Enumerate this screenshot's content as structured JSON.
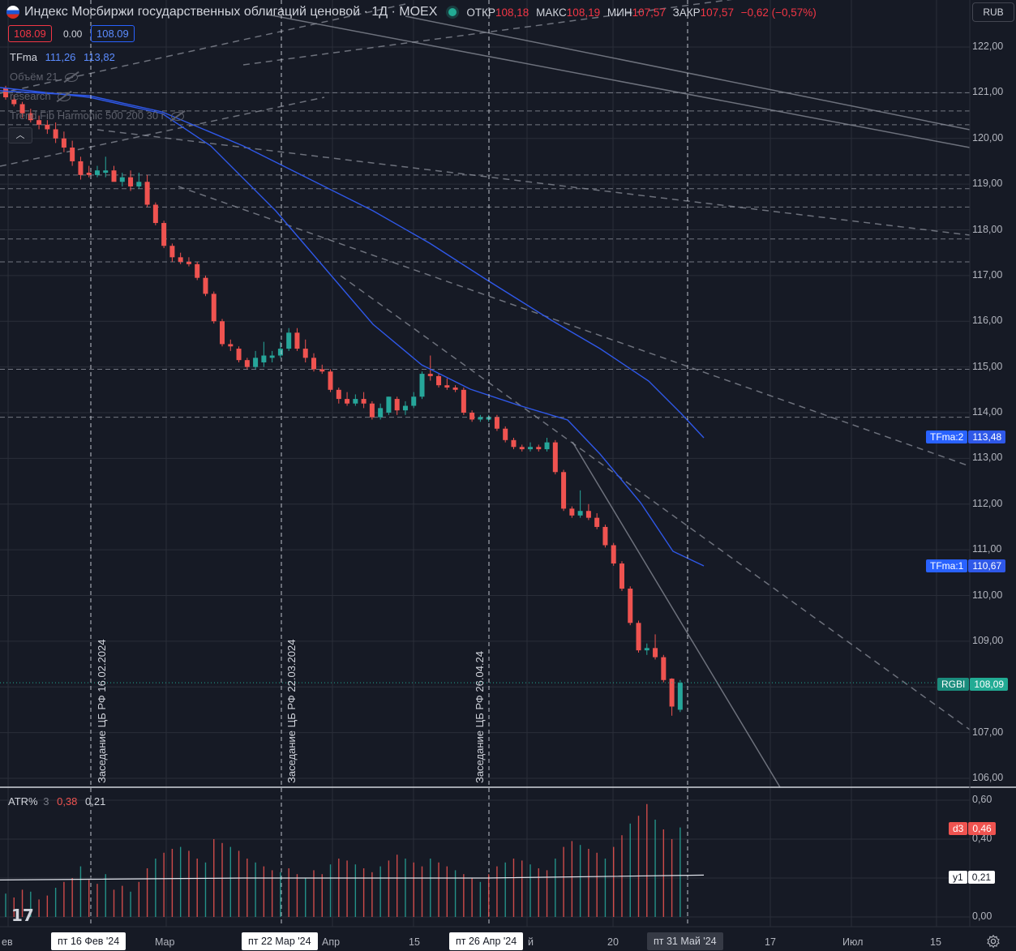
{
  "header": {
    "title": "Индекс Мосбиржи государственных облигаций ценовой · 1Д · MOEX",
    "ohlc": [
      {
        "label": "ОТКР",
        "value": "108,18"
      },
      {
        "label": "МАКС",
        "value": "108,19"
      },
      {
        "label": "МИН",
        "value": "107,57"
      },
      {
        "label": "ЗАКР",
        "value": "107,57"
      }
    ],
    "change": "−0,62 (−0,57%)",
    "sell_price": "108.09",
    "spread": "0.00",
    "buy_price": "108.09",
    "currency": "RUB",
    "collapse_icon": "chevron-up-icon"
  },
  "legend": {
    "tfma_name": "TFma",
    "tfma_v1": "111,26",
    "tfma_v2": "113,82",
    "volume": "Объём 21",
    "research": "research",
    "trend": "Trend Fib Harmonic 500 200 30 r"
  },
  "annotations": [
    "Заседание ЦБ РФ 16.02.2024",
    "Заседание ЦБ РФ 22.03.2024",
    "Заседание ЦБ РФ 26.04.24"
  ],
  "y_axis": {
    "ticks": [
      "122,00",
      "121,00",
      "120,00",
      "119,00",
      "118,00",
      "117,00",
      "116,00",
      "115,00",
      "114,00",
      "113,00",
      "112,00",
      "111,00",
      "110,00",
      "109,00",
      "108,00",
      "107,00",
      "106,00"
    ]
  },
  "price_tags": {
    "tfma2": {
      "label": "TFma:2",
      "value": "113,48"
    },
    "tfma1": {
      "label": "TFma:1",
      "value": "110,67"
    },
    "symbol": {
      "label": "RGBI",
      "value": "108,09"
    }
  },
  "atr": {
    "name": "ATR%",
    "length": "3",
    "v1": "0,38",
    "v2": "0,21",
    "ticks": [
      "0,60",
      "0,40",
      "0,20",
      "0,00"
    ],
    "tag_d3": {
      "label": "d3",
      "value": "0,46"
    },
    "tag_y1": {
      "label": "y1",
      "value": "0,21"
    }
  },
  "x_axis": {
    "labels": [
      "ев",
      "Мар",
      "Апр",
      "15",
      "й",
      "20",
      "17",
      "Июл",
      "15"
    ],
    "boxes": [
      "пт 16 Фев '24",
      "пт 22 Мар '24",
      "пт 26 Апр '24",
      "пт 31 Май '24"
    ]
  },
  "colors": {
    "background": "#161a25",
    "up": "#26a69a",
    "down": "#ef5350",
    "tfma": "#2f58e8",
    "grid": "#2a2e39"
  },
  "chart_data": {
    "type": "candlestick",
    "ylim": [
      105.8,
      122.5
    ],
    "price_levels": [
      121.0,
      120.6,
      120.3,
      119.2,
      118.9,
      118.5,
      117.8,
      117.3,
      114.95,
      113.9
    ],
    "candles": [
      {
        "o": 121.1,
        "h": 121.15,
        "l": 120.85,
        "c": 120.9
      },
      {
        "o": 120.85,
        "h": 120.95,
        "l": 120.7,
        "c": 120.75
      },
      {
        "o": 120.75,
        "h": 120.8,
        "l": 120.45,
        "c": 120.55
      },
      {
        "o": 120.55,
        "h": 120.65,
        "l": 120.35,
        "c": 120.4
      },
      {
        "o": 120.4,
        "h": 120.5,
        "l": 120.2,
        "c": 120.3
      },
      {
        "o": 120.3,
        "h": 120.4,
        "l": 120.1,
        "c": 120.2
      },
      {
        "o": 120.2,
        "h": 120.35,
        "l": 119.9,
        "c": 120.0
      },
      {
        "o": 120.0,
        "h": 120.15,
        "l": 119.7,
        "c": 119.8
      },
      {
        "o": 119.8,
        "h": 119.95,
        "l": 119.4,
        "c": 119.5
      },
      {
        "o": 119.5,
        "h": 119.6,
        "l": 119.1,
        "c": 119.2
      },
      {
        "o": 119.25,
        "h": 119.4,
        "l": 119.15,
        "c": 119.2
      },
      {
        "o": 119.2,
        "h": 119.4,
        "l": 119.15,
        "c": 119.3
      },
      {
        "o": 119.25,
        "h": 119.6,
        "l": 119.15,
        "c": 119.3
      },
      {
        "o": 119.3,
        "h": 119.4,
        "l": 119.1,
        "c": 119.05
      },
      {
        "o": 119.05,
        "h": 119.25,
        "l": 118.95,
        "c": 119.15
      },
      {
        "o": 119.15,
        "h": 119.3,
        "l": 118.85,
        "c": 118.95
      },
      {
        "o": 118.95,
        "h": 119.25,
        "l": 118.9,
        "c": 119.05
      },
      {
        "o": 119.05,
        "h": 119.2,
        "l": 118.5,
        "c": 118.55
      },
      {
        "o": 118.55,
        "h": 118.6,
        "l": 118.1,
        "c": 118.15
      },
      {
        "o": 118.15,
        "h": 118.2,
        "l": 117.6,
        "c": 117.65
      },
      {
        "o": 117.65,
        "h": 117.7,
        "l": 117.3,
        "c": 117.4
      },
      {
        "o": 117.4,
        "h": 117.5,
        "l": 117.25,
        "c": 117.3
      },
      {
        "o": 117.3,
        "h": 117.4,
        "l": 117.2,
        "c": 117.25
      },
      {
        "o": 117.25,
        "h": 117.3,
        "l": 116.9,
        "c": 116.95
      },
      {
        "o": 116.95,
        "h": 117.0,
        "l": 116.55,
        "c": 116.6
      },
      {
        "o": 116.6,
        "h": 116.65,
        "l": 115.95,
        "c": 116.0
      },
      {
        "o": 116.0,
        "h": 116.05,
        "l": 115.45,
        "c": 115.5
      },
      {
        "o": 115.5,
        "h": 115.6,
        "l": 115.35,
        "c": 115.45
      },
      {
        "o": 115.4,
        "h": 115.45,
        "l": 115.1,
        "c": 115.15
      },
      {
        "o": 115.15,
        "h": 115.2,
        "l": 114.95,
        "c": 115.0
      },
      {
        "o": 115.0,
        "h": 115.35,
        "l": 114.95,
        "c": 115.2
      },
      {
        "o": 115.1,
        "h": 115.55,
        "l": 115.0,
        "c": 115.25
      },
      {
        "o": 115.2,
        "h": 115.35,
        "l": 115.1,
        "c": 115.25
      },
      {
        "o": 115.25,
        "h": 115.55,
        "l": 115.2,
        "c": 115.4
      },
      {
        "o": 115.4,
        "h": 115.85,
        "l": 115.35,
        "c": 115.75
      },
      {
        "o": 115.75,
        "h": 115.85,
        "l": 115.35,
        "c": 115.4
      },
      {
        "o": 115.4,
        "h": 115.6,
        "l": 115.1,
        "c": 115.2
      },
      {
        "o": 115.2,
        "h": 115.3,
        "l": 114.9,
        "c": 114.95
      },
      {
        "o": 114.95,
        "h": 115.05,
        "l": 114.85,
        "c": 114.9
      },
      {
        "o": 114.9,
        "h": 114.95,
        "l": 114.45,
        "c": 114.5
      },
      {
        "o": 114.5,
        "h": 114.55,
        "l": 114.2,
        "c": 114.3
      },
      {
        "o": 114.3,
        "h": 114.45,
        "l": 114.15,
        "c": 114.2
      },
      {
        "o": 114.2,
        "h": 114.4,
        "l": 114.15,
        "c": 114.3
      },
      {
        "o": 114.3,
        "h": 114.45,
        "l": 114.1,
        "c": 114.2
      },
      {
        "o": 114.2,
        "h": 114.25,
        "l": 113.85,
        "c": 113.9
      },
      {
        "o": 113.9,
        "h": 114.2,
        "l": 113.85,
        "c": 114.1
      },
      {
        "o": 114.0,
        "h": 114.35,
        "l": 113.95,
        "c": 114.35
      },
      {
        "o": 114.3,
        "h": 114.35,
        "l": 113.95,
        "c": 114.05
      },
      {
        "o": 114.05,
        "h": 114.25,
        "l": 113.95,
        "c": 114.15
      },
      {
        "o": 114.15,
        "h": 114.45,
        "l": 114.1,
        "c": 114.35
      },
      {
        "o": 114.35,
        "h": 114.9,
        "l": 114.3,
        "c": 114.85
      },
      {
        "o": 114.85,
        "h": 115.25,
        "l": 114.7,
        "c": 114.8
      },
      {
        "o": 114.8,
        "h": 114.85,
        "l": 114.55,
        "c": 114.6
      },
      {
        "o": 114.6,
        "h": 114.75,
        "l": 114.5,
        "c": 114.55
      },
      {
        "o": 114.55,
        "h": 114.6,
        "l": 114.45,
        "c": 114.5
      },
      {
        "o": 114.5,
        "h": 114.55,
        "l": 113.95,
        "c": 114.0
      },
      {
        "o": 114.0,
        "h": 114.05,
        "l": 113.8,
        "c": 113.85
      },
      {
        "o": 113.85,
        "h": 113.95,
        "l": 113.8,
        "c": 113.9
      },
      {
        "o": 113.85,
        "h": 113.95,
        "l": 113.8,
        "c": 113.9
      },
      {
        "o": 113.9,
        "h": 113.95,
        "l": 113.6,
        "c": 113.65
      },
      {
        "o": 113.65,
        "h": 113.7,
        "l": 113.35,
        "c": 113.4
      },
      {
        "o": 113.4,
        "h": 113.45,
        "l": 113.2,
        "c": 113.25
      },
      {
        "o": 113.25,
        "h": 113.3,
        "l": 113.15,
        "c": 113.2
      },
      {
        "o": 113.2,
        "h": 113.35,
        "l": 113.15,
        "c": 113.25
      },
      {
        "o": 113.25,
        "h": 113.3,
        "l": 113.15,
        "c": 113.2
      },
      {
        "o": 113.2,
        "h": 113.45,
        "l": 113.15,
        "c": 113.35
      },
      {
        "o": 113.35,
        "h": 113.4,
        "l": 112.65,
        "c": 112.7
      },
      {
        "o": 112.7,
        "h": 112.75,
        "l": 111.85,
        "c": 111.9
      },
      {
        "o": 111.9,
        "h": 111.95,
        "l": 111.7,
        "c": 111.75
      },
      {
        "o": 111.75,
        "h": 112.3,
        "l": 111.7,
        "c": 111.85
      },
      {
        "o": 111.85,
        "h": 112.0,
        "l": 111.65,
        "c": 111.7
      },
      {
        "o": 111.7,
        "h": 111.8,
        "l": 111.45,
        "c": 111.5
      },
      {
        "o": 111.5,
        "h": 111.55,
        "l": 111.05,
        "c": 111.1
      },
      {
        "o": 111.1,
        "h": 111.15,
        "l": 110.65,
        "c": 110.7
      },
      {
        "o": 110.7,
        "h": 110.75,
        "l": 110.1,
        "c": 110.15
      },
      {
        "o": 110.15,
        "h": 110.2,
        "l": 109.35,
        "c": 109.4
      },
      {
        "o": 109.4,
        "h": 109.45,
        "l": 108.75,
        "c": 108.8
      },
      {
        "o": 108.8,
        "h": 108.95,
        "l": 108.7,
        "c": 108.85
      },
      {
        "o": 108.85,
        "h": 109.15,
        "l": 108.6,
        "c": 108.65
      },
      {
        "o": 108.65,
        "h": 108.7,
        "l": 108.1,
        "c": 108.15
      },
      {
        "o": 108.18,
        "h": 108.19,
        "l": 107.37,
        "c": 107.57
      },
      {
        "o": 107.5,
        "h": 108.15,
        "l": 107.45,
        "c": 108.09
      }
    ],
    "atr_values": [
      0.12,
      0.1,
      0.14,
      0.13,
      0.09,
      0.11,
      0.15,
      0.18,
      0.2,
      0.26,
      0.19,
      0.17,
      0.22,
      0.14,
      0.16,
      0.13,
      0.18,
      0.25,
      0.3,
      0.33,
      0.35,
      0.36,
      0.34,
      0.3,
      0.28,
      0.4,
      0.38,
      0.36,
      0.34,
      0.3,
      0.28,
      0.26,
      0.24,
      0.23,
      0.25,
      0.22,
      0.2,
      0.24,
      0.22,
      0.27,
      0.3,
      0.29,
      0.27,
      0.25,
      0.23,
      0.26,
      0.29,
      0.32,
      0.3,
      0.28,
      0.26,
      0.3,
      0.28,
      0.26,
      0.24,
      0.22,
      0.2,
      0.18,
      0.22,
      0.26,
      0.28,
      0.3,
      0.29,
      0.27,
      0.25,
      0.24,
      0.3,
      0.36,
      0.39,
      0.37,
      0.35,
      0.33,
      0.3,
      0.36,
      0.42,
      0.48,
      0.52,
      0.58,
      0.5,
      0.45,
      0.4,
      0.46
    ],
    "atr_ylim": [
      0,
      0.62
    ],
    "atr_avg": 0.21
  }
}
